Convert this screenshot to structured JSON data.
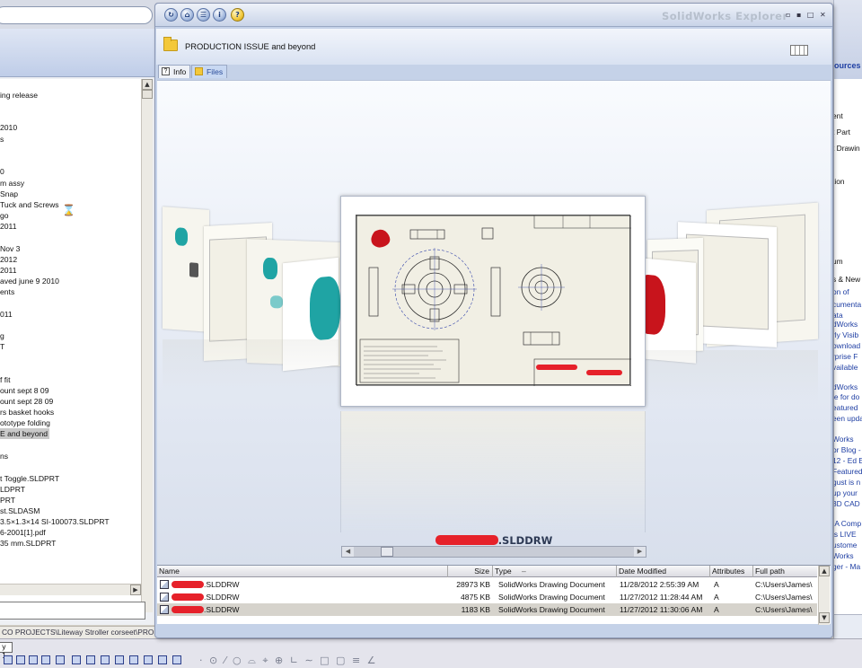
{
  "background_tree": {
    "lines": [
      "ing release",
      "2010",
      "s",
      "0",
      "m assy",
      "Snap",
      "Tuck and Screws",
      "go",
      "2011",
      "Nov 3",
      "2012",
      "2011",
      "aved june 9 2010",
      "ents",
      "011",
      "g",
      "T",
      "f fit",
      "ount sept 8 09",
      "ount sept 28 09",
      "rs basket hooks",
      "ototype folding",
      "E and beyond",
      "ns",
      "t Toggle.SLDPRT",
      "LDPRT",
      "PRT",
      "st.SLDASM",
      "3.5×1.3×14 SI-100073.SLDPRT",
      "6-2001[1].pdf",
      "35 mm.SLDPRT"
    ],
    "selected_line": "E and beyond"
  },
  "status_path": "CO PROJECTS\\Liteway Stroller corseet\\PRODUCTION ISSUE and beyond",
  "bottom_tab_label": "y 1",
  "right_pane": {
    "title": "ources",
    "lines": [
      "ent",
      "t Part",
      "t Drawin",
      "tion",
      "l",
      "um",
      "s & New",
      "on of",
      "cumenta",
      "ata",
      "dWorks",
      "rly Visib",
      "ownload",
      "rprise F",
      "vailable",
      "dWorks",
      "le for do",
      "eatured",
      "een upda",
      "Works",
      "or Blog -",
      "12 - Ed E",
      "Featured",
      "gust is n",
      "up your",
      "3D CAD",
      "IA Comp",
      "is LIVE",
      "ustome",
      "Works",
      "ger - Ma",
      "ces",
      "Manufactu"
    ]
  },
  "window": {
    "title": "SolidWorks Explorer",
    "toolbar_icons": [
      "refresh-icon",
      "home-icon",
      "options-icon",
      "info-icon",
      "help-icon"
    ],
    "folder_name": "PRODUCTION ISSUE and beyond",
    "tabs": [
      {
        "label": "Info",
        "active": false
      },
      {
        "label": "Files",
        "active": true
      }
    ]
  },
  "coverflow": {
    "current_file_suffix": ".SLDDRW",
    "slider_position": 0.1
  },
  "file_table": {
    "columns": [
      "Name",
      "Size",
      "Type",
      "Date Modified",
      "Attributes",
      "Full path"
    ],
    "rows": [
      {
        "name_suffix": ".SLDDRW",
        "size": "28973 KB",
        "type": "SolidWorks Drawing Document",
        "date": "11/28/2012 2:55:39 AM",
        "attr": "A",
        "path": "C:\\Users\\James\\"
      },
      {
        "name_suffix": ".SLDDRW",
        "size": "4875 KB",
        "type": "SolidWorks Drawing Document",
        "date": "11/27/2012 11:28:44 AM",
        "attr": "A",
        "path": "C:\\Users\\James\\"
      },
      {
        "name_suffix": ".SLDDRW",
        "size": "1183 KB",
        "type": "SolidWorks Drawing Document",
        "date": "11/27/2012 11:30:06 AM",
        "attr": "A",
        "path": "C:\\Users\\James\\"
      }
    ],
    "selected_row": 2
  },
  "colors": {
    "accent": "#2a4c9a",
    "redaction": "#e6212a",
    "part_red": "#c8141c",
    "part_teal": "#1fa4a4"
  }
}
